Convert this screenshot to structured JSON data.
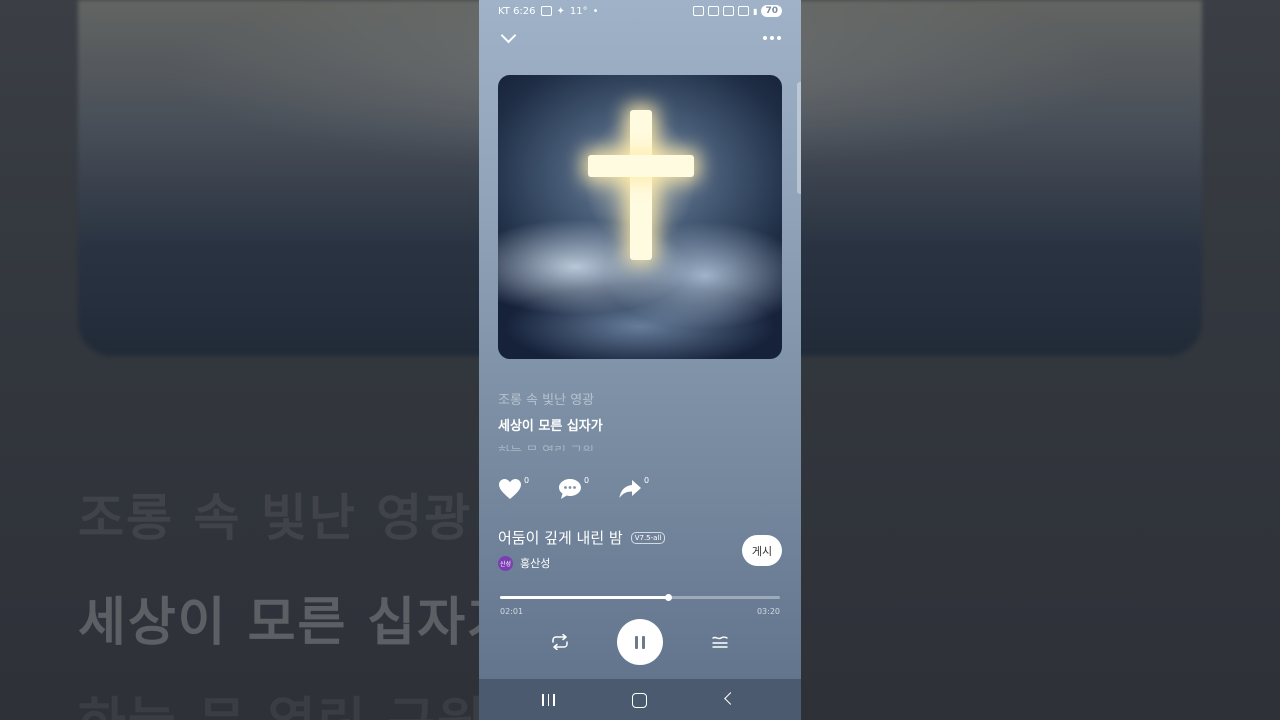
{
  "status_bar": {
    "carrier_time": "KT 6:26",
    "extra": "11°",
    "battery": "70"
  },
  "lyrics": {
    "previous": "조롱 속 빛난 영광",
    "current": "세상이 모른 십자가",
    "next": "하늘 문 열린 구원"
  },
  "actions": {
    "likes": "0",
    "comments": "0",
    "shares": "0"
  },
  "song": {
    "title": "어둠이 깊게 내린 밤",
    "version": "V7.5-all",
    "artist": "홍산성",
    "artist_avatar_text": "산성"
  },
  "post_button": "게시",
  "playback": {
    "current_time": "02:01",
    "duration": "03:20",
    "progress": 0.6
  },
  "colors": {
    "accent": "#ffffff",
    "avatar": "#7b3fb2"
  }
}
